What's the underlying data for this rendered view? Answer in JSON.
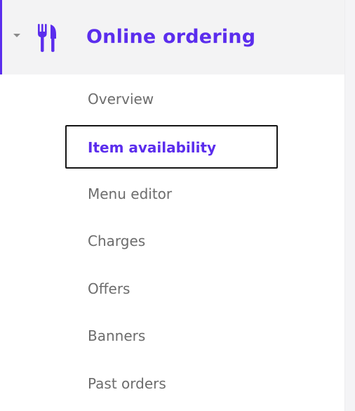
{
  "section": {
    "title": "Online ordering",
    "icon": "fork-knife-icon",
    "expanded": true,
    "accent_color": "#5b2ded"
  },
  "menu_items": [
    {
      "label": "Overview",
      "active": false
    },
    {
      "label": "Item availability",
      "active": true
    },
    {
      "label": "Menu editor",
      "active": false
    },
    {
      "label": "Charges",
      "active": false
    },
    {
      "label": "Offers",
      "active": false
    },
    {
      "label": "Banners",
      "active": false
    },
    {
      "label": "Past orders",
      "active": false
    }
  ],
  "colors": {
    "accent": "#5b2ded",
    "inactive_text": "#6c6c6c",
    "header_bg": "#f3f3f4"
  }
}
